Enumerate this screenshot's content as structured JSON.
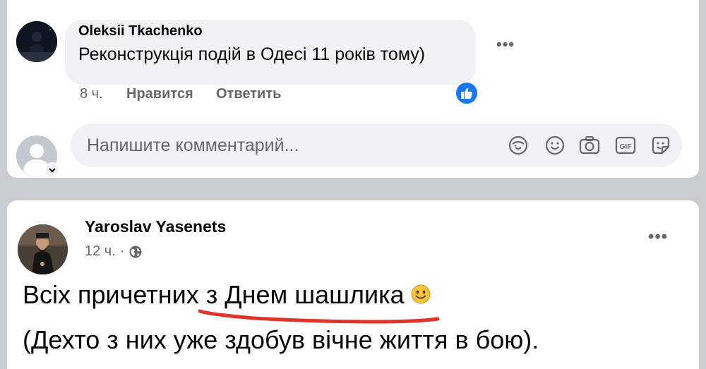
{
  "comment": {
    "author": "Oleksii Tkachenko",
    "text": "Реконструкція подій в Одесі 11 років тому)",
    "time": "8 ч.",
    "like_label": "Нравится",
    "reply_label": "Ответить",
    "more_icon": "more-horizontal-icon",
    "reaction_icon": "like-reaction-icon"
  },
  "composer": {
    "placeholder": "Напишите комментарий...",
    "icons": [
      "avatar-sticker-icon",
      "emoji-icon",
      "camera-icon",
      "gif-icon",
      "sticker-icon"
    ]
  },
  "post": {
    "author": "Yaroslav Yasenets",
    "time": "12 ч.",
    "separator": "·",
    "audience_icon": "globe-icon",
    "line1": "Всіх причетних з Днем шашлика",
    "line2": "(Дехто з них уже здобув вічне життя в бою).",
    "more_icon": "more-horizontal-icon",
    "emoji": "smiling-face-emoji",
    "underline_color": "#e0342b"
  },
  "colors": {
    "accent": "#1877f2",
    "secondary_text": "#65676b",
    "bubble": "#f0f2f5",
    "feed_background": "#c9ccd1"
  }
}
